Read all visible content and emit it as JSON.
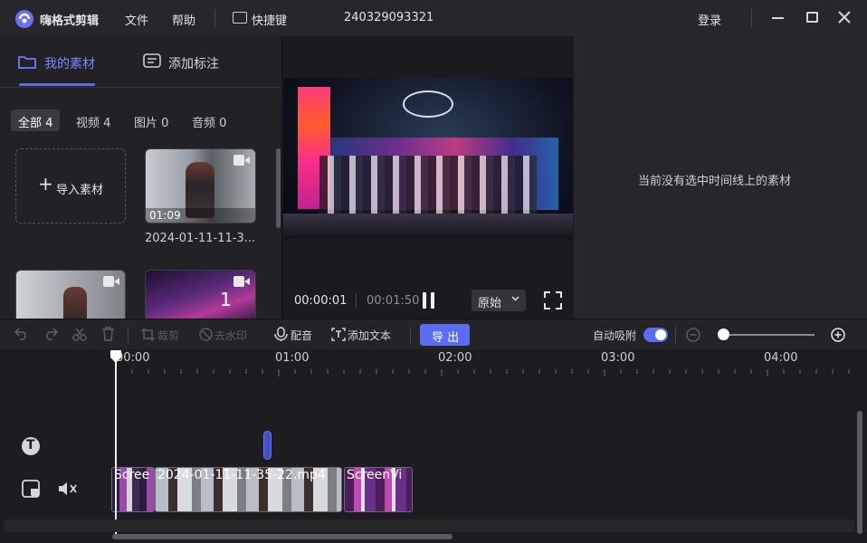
{
  "app": {
    "name": "嗨格式剪辑",
    "menu_file": "文件",
    "menu_help": "帮助",
    "shortcuts": "快捷键",
    "project_id": "240329093321",
    "login": "登录"
  },
  "library": {
    "tab_assets": "我的素材",
    "tab_annotate": "添加标注",
    "filters": [
      "全部 4",
      "视频 4",
      "图片 0",
      "音频 0"
    ],
    "import_label": "导入素材",
    "items": [
      {
        "duration": "01:09",
        "name": "2024-01-11-11-3..."
      },
      {
        "badge": "1"
      }
    ]
  },
  "player": {
    "current": "00:00:01",
    "total": "00:01:50",
    "ratio": "原始"
  },
  "props": {
    "empty_text": "当前没有选中时间线上的素材"
  },
  "toolbar": {
    "crop": "裁剪",
    "watermark": "去水印",
    "dub": "配音",
    "add_text": "添加文本",
    "export": "导 出",
    "snap": "自动吸附"
  },
  "timeline": {
    "ticks": [
      "00:00",
      "01:00",
      "02:00",
      "03:00",
      "04:00"
    ],
    "clips": [
      {
        "label": "Scree"
      },
      {
        "label": "2024-01-11-11-35-22.mp4"
      },
      {
        "label": "ScreenVi"
      }
    ]
  },
  "colors": {
    "accent": "#5b6cf2",
    "panel": "#26262b",
    "bg": "#1b1b1f"
  }
}
